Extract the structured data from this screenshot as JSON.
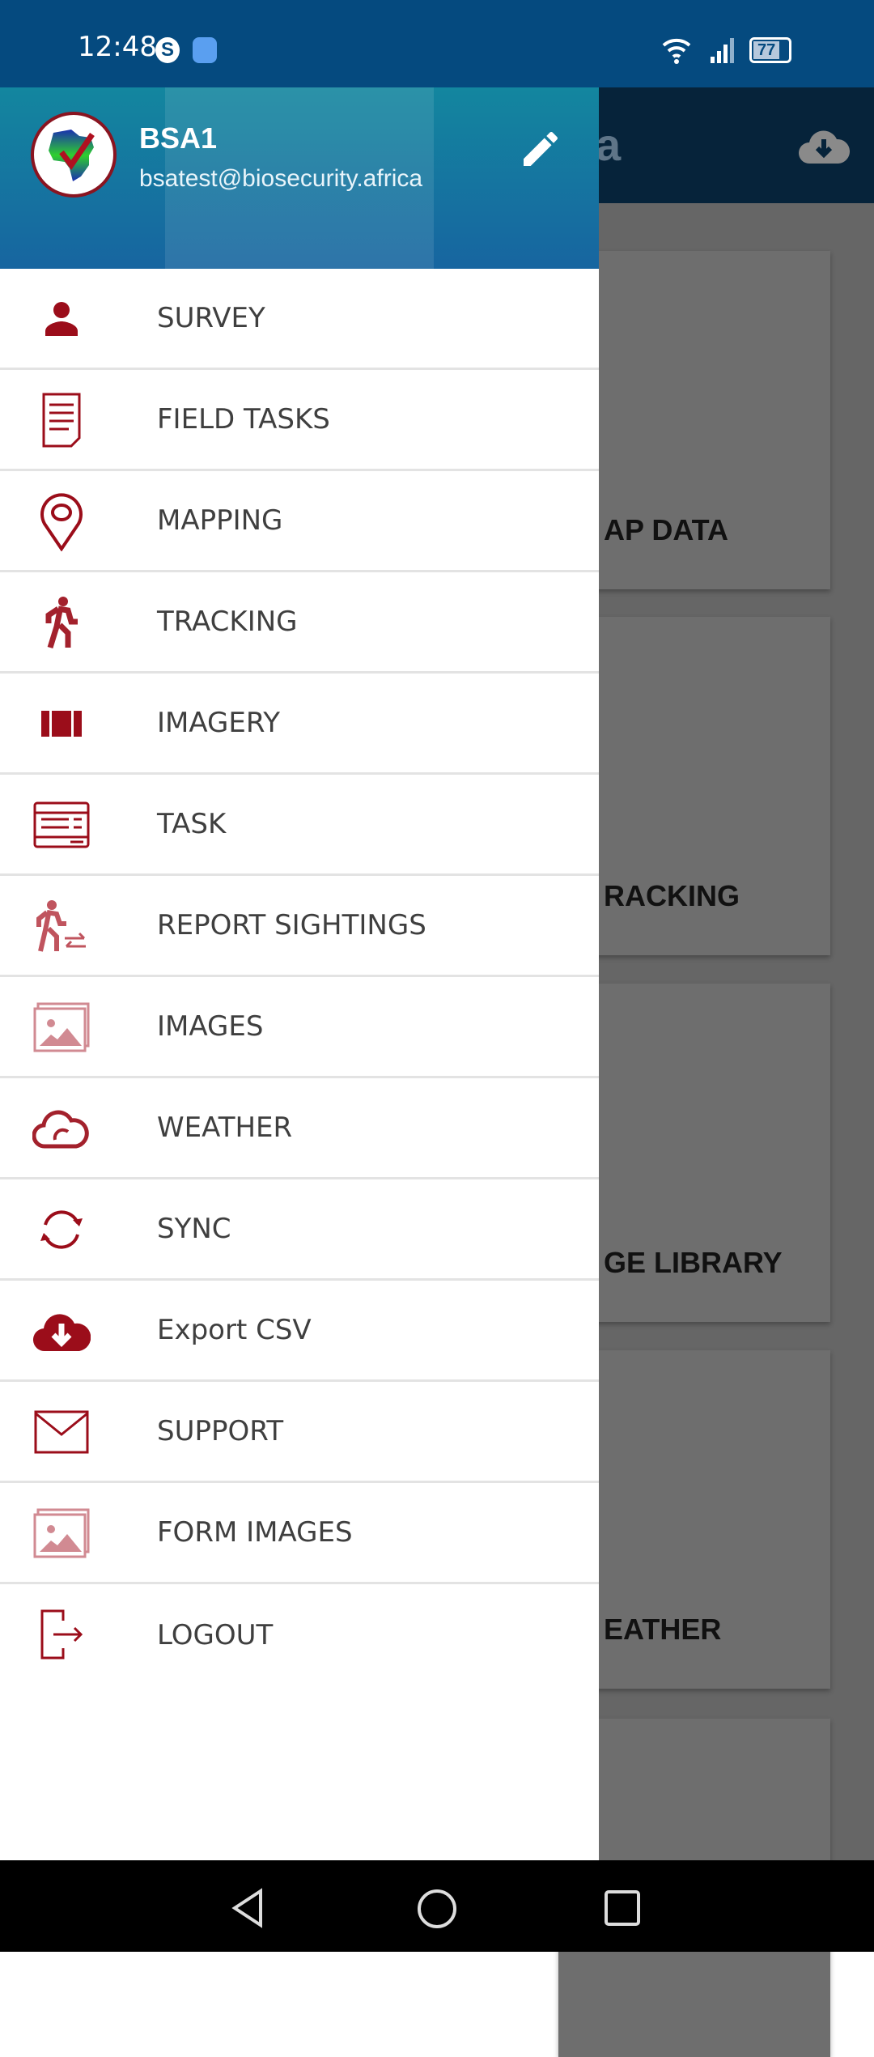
{
  "status_bar": {
    "time": "12:48",
    "battery": "77",
    "icons": [
      "skype-icon",
      "mail-icon",
      "wifi-icon",
      "signal-icon",
      "battery-icon"
    ]
  },
  "background_app": {
    "title_fragment": "a",
    "cards": [
      {
        "label": "AP DATA"
      },
      {
        "label": "RACKING"
      },
      {
        "label": "GE LIBRARY"
      },
      {
        "label": "EATHER"
      },
      {
        "label": ""
      }
    ]
  },
  "drawer": {
    "user_name": "BSA1",
    "user_email": "bsatest@biosecurity.africa",
    "items": [
      {
        "label": "SURVEY",
        "icon": "person-icon"
      },
      {
        "label": "FIELD TASKS",
        "icon": "document-icon"
      },
      {
        "label": "MAPPING",
        "icon": "map-pin-icon"
      },
      {
        "label": "TRACKING",
        "icon": "walking-icon"
      },
      {
        "label": "IMAGERY",
        "icon": "film-strip-icon"
      },
      {
        "label": "TASK",
        "icon": "form-icon"
      },
      {
        "label": "REPORT SIGHTINGS",
        "icon": "walking-exchange-icon"
      },
      {
        "label": "IMAGES",
        "icon": "image-gallery-icon"
      },
      {
        "label": "WEATHER",
        "icon": "cloud-icon"
      },
      {
        "label": "SYNC",
        "icon": "sync-icon"
      },
      {
        "label": "Export CSV",
        "icon": "cloud-download-icon"
      },
      {
        "label": "SUPPORT",
        "icon": "envelope-icon"
      },
      {
        "label": "FORM IMAGES",
        "icon": "image-gallery-icon"
      },
      {
        "label": "LOGOUT",
        "icon": "logout-icon"
      }
    ]
  },
  "colors": {
    "accent": "#9b0d1a",
    "accent_light": "#c9707a",
    "header": "#054a7f"
  }
}
